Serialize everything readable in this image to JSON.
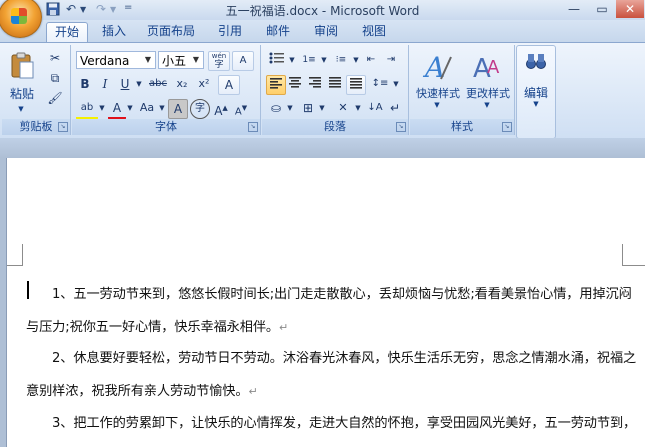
{
  "window": {
    "title": "五一祝福语.docx - Microsoft Word",
    "minimize": "—",
    "restore": "▭",
    "close": "✕"
  },
  "qat": {
    "save_icon": "save-icon",
    "undo": "↶",
    "redo": "↷",
    "more": "="
  },
  "tabs": [
    "开始",
    "插入",
    "页面布局",
    "引用",
    "邮件",
    "审阅",
    "视图"
  ],
  "active_tab": "开始",
  "clipboard": {
    "paste_label": "粘贴",
    "group_label": "剪贴板"
  },
  "font": {
    "name": "Verdana",
    "size": "小五",
    "group_label": "字体",
    "bold": "B",
    "italic": "I",
    "underline": "U",
    "strike": "abc",
    "subscript": "x₂",
    "superscript": "x²",
    "clear": "A",
    "highlight": "ab",
    "font_color": "A",
    "change_case": "Aa",
    "char_shading": "A",
    "enclose": "字",
    "grow": "A",
    "shrink": "A",
    "phonetic": "wén"
  },
  "paragraph": {
    "group_label": "段落"
  },
  "styles": {
    "quick_label": "快速样式",
    "change_label": "更改样式",
    "group_label": "样式"
  },
  "editing": {
    "label": "编辑"
  },
  "document": {
    "lines": [
      "1、五一劳动节来到，悠悠长假时间长;出门走走散散心，丢却烦恼与忧愁;看看美景怡心情，用掉沉闷",
      "与压力;祝你五一好心情，快乐幸福永相伴。",
      "2、休息要好要轻松，劳动节日不劳动。沐浴春光沐春风，快乐生活乐无穷，思念之情潮水涌，祝福之",
      "意别样浓，祝我所有亲人劳动节愉快。",
      "3、把工作的劳累卸下，让快乐的心情挥发，走进大自然的怀抱，享受田园风光美好，五一劳动节到，"
    ],
    "para_mark": "↵"
  }
}
